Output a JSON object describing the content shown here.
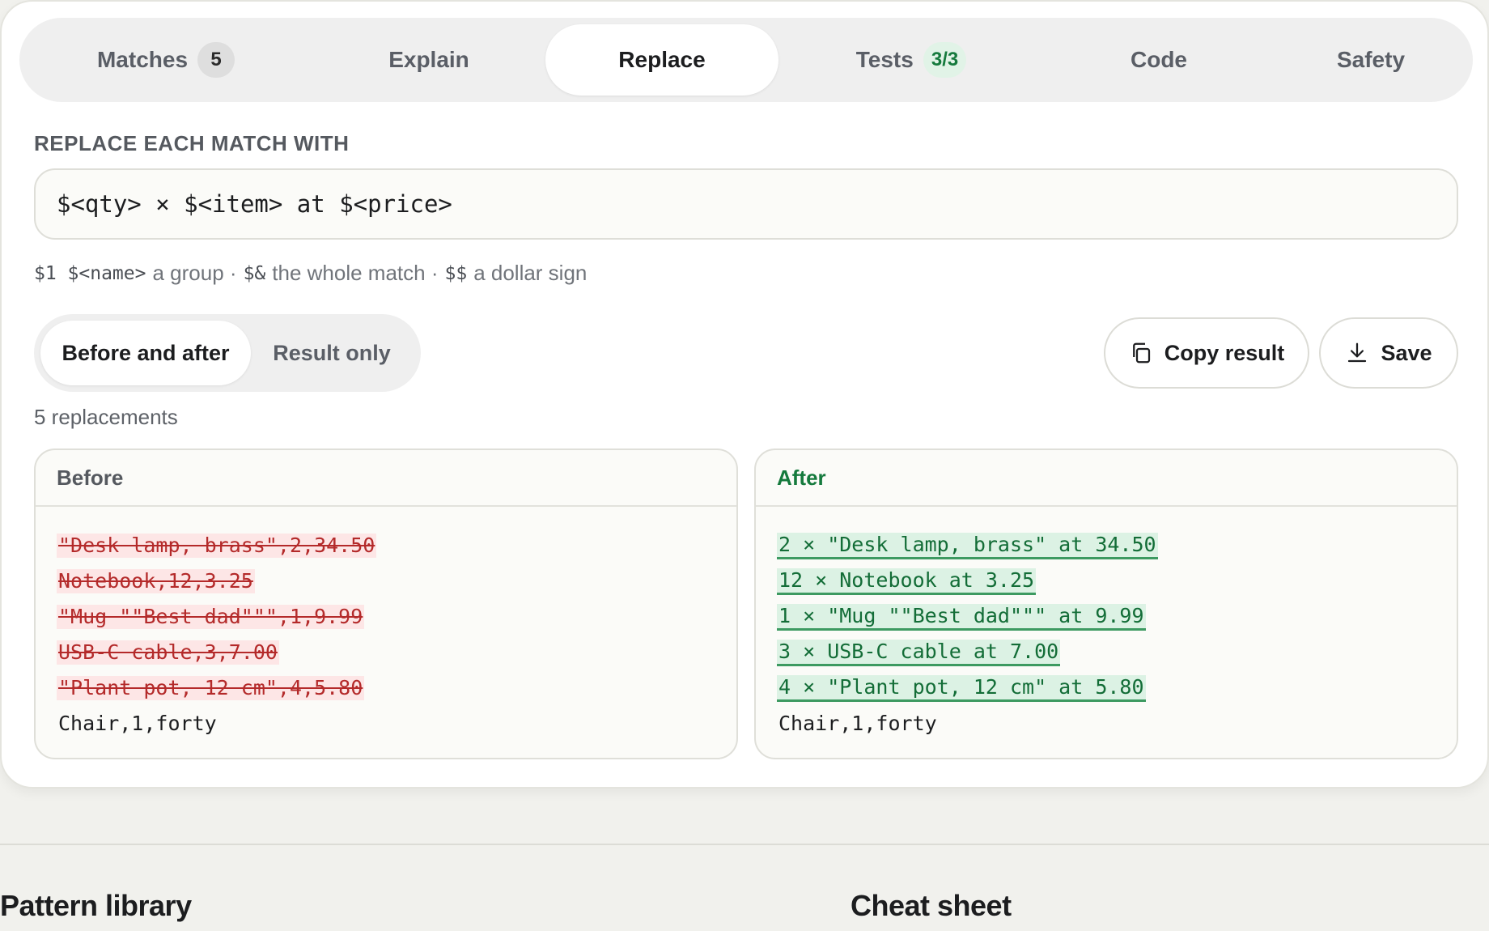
{
  "tabs": [
    {
      "label": "Matches",
      "badge": "5"
    },
    {
      "label": "Explain"
    },
    {
      "label": "Replace"
    },
    {
      "label": "Tests",
      "badge": "3/3"
    },
    {
      "label": "Code"
    },
    {
      "label": "Safety"
    }
  ],
  "replace": {
    "section_label": "REPLACE EACH MATCH WITH",
    "input_value": "$<qty> × $<item> at $<price>",
    "hint": {
      "group_tokens": "$1 $<name>",
      "group_text": "a group ·",
      "whole_token": "$&",
      "whole_text": "the whole match ·",
      "dollar_token": "$$",
      "dollar_text": "a dollar sign"
    }
  },
  "view_toggle": {
    "before_after": "Before and after",
    "result_only": "Result only"
  },
  "actions": {
    "copy": "Copy result",
    "save": "Save"
  },
  "replacement_count": "5 replacements",
  "before": {
    "title": "Before",
    "lines": [
      "\"Desk lamp, brass\",2,34.50",
      "Notebook,12,3.25",
      "\"Mug \"\"Best dad\"\"\",1,9.99",
      "USB-C cable,3,7.00",
      "\"Plant pot, 12 cm\",4,5.80",
      "Chair,1,forty"
    ]
  },
  "after": {
    "title": "After",
    "lines": [
      "2 × \"Desk lamp, brass\" at 34.50",
      "12 × Notebook at 3.25",
      "1 × \"Mug \"\"Best dad\"\"\" at 9.99",
      "3 × USB-C cable at 7.00",
      "4 × \"Plant pot, 12 cm\" at 5.80",
      "Chair,1,forty"
    ]
  },
  "footer": {
    "left_heading": "Pattern library",
    "right_heading": "Cheat sheet"
  },
  "colors": {
    "accent_green": "#157a3d",
    "deleted_red": "#b42a2a",
    "deleted_bg": "#fde6e6",
    "inserted_bg": "#dcf2e4"
  },
  "icons": {
    "copy": "copy-icon",
    "save": "download-icon"
  }
}
